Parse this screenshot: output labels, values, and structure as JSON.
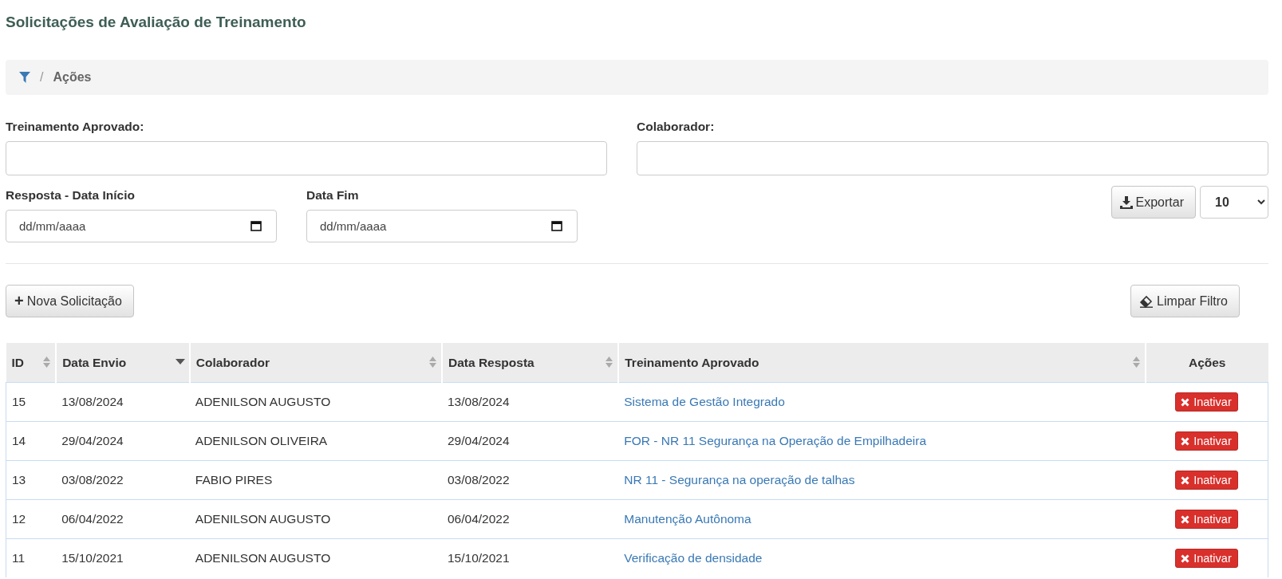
{
  "page_title": "Solicitações de Avaliação de Treinamento",
  "breadcrumb": {
    "separator": "/",
    "current": "Ações"
  },
  "filters": {
    "treinamento": {
      "label": "Treinamento Aprovado:"
    },
    "colaborador": {
      "label": "Colaborador:"
    },
    "data_inicio": {
      "label": "Resposta - Data Início",
      "placeholder": "dd/mm/aaaa"
    },
    "data_fim": {
      "label": "Data Fim",
      "placeholder": "dd/mm/aaaa"
    }
  },
  "export_button": "Exportar",
  "page_size": "10",
  "new_button": {
    "icon": "+",
    "label": "Nova Solicitação"
  },
  "clear_button": "Limpar Filtro",
  "table": {
    "columns": [
      {
        "label": "ID",
        "kind": "sortable"
      },
      {
        "label": "Data Envio",
        "kind": "sorted"
      },
      {
        "label": "Colaborador",
        "kind": "sortable"
      },
      {
        "label": "Data Resposta",
        "kind": "sortable"
      },
      {
        "label": "Treinamento Aprovado",
        "kind": "sortable"
      },
      {
        "label": "Ações",
        "kind": "plain"
      }
    ],
    "rows": [
      {
        "id": "15",
        "data_envio": "13/08/2024",
        "colaborador": "ADENILSON AUGUSTO",
        "data_resposta": "13/08/2024",
        "treinamento": "Sistema de Gestão Integrado",
        "action": "Inativar"
      },
      {
        "id": "14",
        "data_envio": "29/04/2024",
        "colaborador": "ADENILSON OLIVEIRA",
        "data_resposta": "29/04/2024",
        "treinamento": "FOR - NR 11 Segurança na Operação de Empilhadeira",
        "action": "Inativar"
      },
      {
        "id": "13",
        "data_envio": "03/08/2022",
        "colaborador": "FABIO PIRES",
        "data_resposta": "03/08/2022",
        "treinamento": "NR 11 - Segurança na operação de talhas",
        "action": "Inativar"
      },
      {
        "id": "12",
        "data_envio": "06/04/2022",
        "colaborador": "ADENILSON AUGUSTO",
        "data_resposta": "06/04/2022",
        "treinamento": "Manutenção Autônoma",
        "action": "Inativar"
      },
      {
        "id": "11",
        "data_envio": "15/10/2021",
        "colaborador": "ADENILSON AUGUSTO",
        "data_resposta": "15/10/2021",
        "treinamento": "Verificação de densidade",
        "action": "Inativar"
      }
    ]
  }
}
